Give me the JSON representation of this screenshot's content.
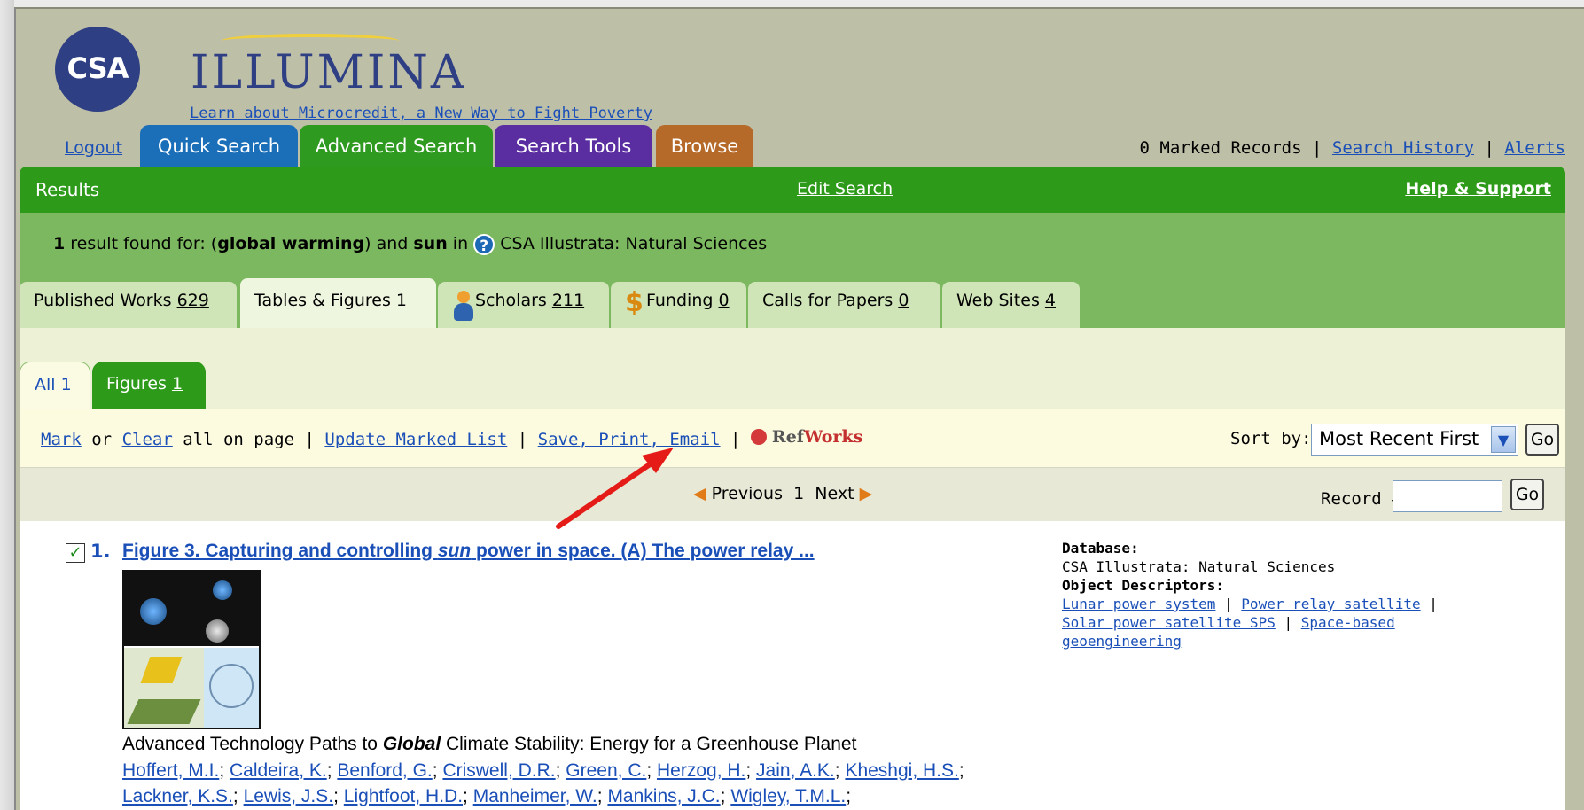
{
  "header": {
    "logo_text": "CSA",
    "brand": "ILLUMINA",
    "tagline": "Learn about Microcredit, a New Way to Fight Poverty"
  },
  "nav": {
    "logout": "Logout",
    "tabs": [
      "Quick Search",
      "Advanced Search",
      "Search Tools",
      "Browse"
    ],
    "marked_records": "0 Marked Records",
    "search_history": "Search History",
    "alerts": "Alerts"
  },
  "results_bar": {
    "label": "Results",
    "edit_search": "Edit Search",
    "help": "Help & Support"
  },
  "summary": {
    "count": "1",
    "text_found": "result found for: (",
    "term1": "global warming",
    "text_and": ") and",
    "term2": "sun",
    "text_in": "in",
    "database": "CSA Illustrata: Natural Sciences"
  },
  "result_tabs": {
    "published": {
      "label": "Published Works",
      "count": "629"
    },
    "tables": {
      "label": "Tables & Figures",
      "count": "1"
    },
    "scholars": {
      "label": "Scholars",
      "count": "211"
    },
    "funding": {
      "label": "Funding",
      "count": "0"
    },
    "calls": {
      "label": "Calls for Papers",
      "count": "0"
    },
    "web": {
      "label": "Web Sites",
      "count": "4"
    }
  },
  "sub_tabs": {
    "all": "All 1",
    "figures_label": "Figures",
    "figures_count": "1"
  },
  "actions": {
    "mark": "Mark",
    "or": "or",
    "clear": "Clear",
    "all_on_page": "all on page |",
    "update": "Update Marked List",
    "sep": "|",
    "save": "Save, Print, Email",
    "refworks_ref": "Ref",
    "refworks_works": "Works",
    "sort_label": "Sort by:",
    "sort_value": "Most Recent First",
    "go": "Go"
  },
  "pagination": {
    "previous": "Previous",
    "page": "1",
    "next": "Next",
    "record_label": "Record #",
    "go": "Go"
  },
  "record": {
    "number": "1.",
    "title_part1": "Figure 3. Capturing and controlling",
    "title_em": "sun",
    "title_part2": "power in space. (A) The power relay ...",
    "book_pre": "Advanced Technology Paths to",
    "book_em": "Global",
    "book_post": "Climate Stability: Energy for a Greenhouse Planet",
    "authors": [
      "Hoffert, M.I.",
      "Caldeira, K.",
      "Benford, G.",
      "Criswell, D.R.",
      "Green, C.",
      "Herzog, H.",
      "Jain, A.K.",
      "Kheshgi, H.S.",
      "Lackner, K.S.",
      "Lewis, J.S.",
      "Lightfoot, H.D.",
      "Manheimer, W.",
      "Mankins, J.C.",
      "Wigley, T.M.L."
    ]
  },
  "meta": {
    "database_label": "Database:",
    "database_value": "CSA Illustrata: Natural Sciences",
    "descriptors_label": "Object Descriptors:",
    "descriptors": [
      "Lunar power system",
      "Power relay satellite",
      "Solar power satellite SPS",
      "Space-based geoengineering"
    ]
  },
  "colors": {
    "brand_blue": "#2e3f84",
    "results_green": "#2d9a19",
    "link_blue": "#1a4fb8",
    "annotation_red": "#e41b17"
  }
}
